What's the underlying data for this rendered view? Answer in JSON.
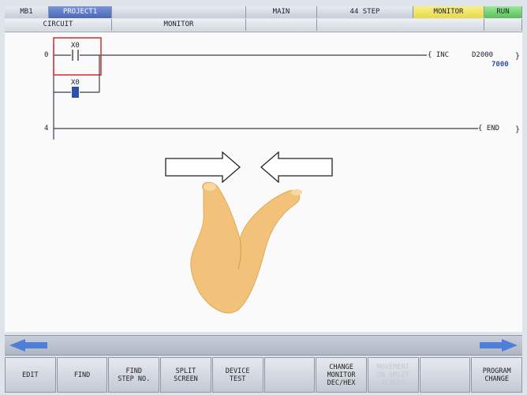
{
  "header": {
    "cells": [
      {
        "text": "MB1",
        "style": "normal"
      },
      {
        "text": "PROJECT1",
        "style": "proj"
      },
      {
        "text": "",
        "style": "normal"
      },
      {
        "text": "MAIN",
        "style": "normal"
      },
      {
        "text": "44 STEP",
        "style": "normal"
      },
      {
        "text": "MONITOR",
        "style": "mon"
      },
      {
        "text": "RUN",
        "style": "run"
      }
    ]
  },
  "subheader": {
    "cells": [
      "CIRCUIT",
      "MONITOR",
      "",
      "",
      ""
    ]
  },
  "ladder": {
    "rungs": [
      {
        "step": "0",
        "contact": "X0",
        "instruction": "{ INC",
        "device": "D2000",
        "value": "7000"
      },
      {
        "step": "",
        "contact": "X0"
      },
      {
        "step": "4",
        "instruction": "{ END"
      }
    ]
  },
  "gesture": {
    "left_arrow_icon": "arrow-right-outline",
    "right_arrow_icon": "arrow-left-outline",
    "hand_icon": "pinch-hand"
  },
  "navigation": {
    "left_icon": "arrow-left-blue",
    "right_icon": "arrow-right-blue"
  },
  "function_keys": [
    {
      "label": "EDIT",
      "disabled": false
    },
    {
      "label": "FIND",
      "disabled": false
    },
    {
      "label": "FIND\nSTEP NO.",
      "disabled": false
    },
    {
      "label": "SPLIT\nSCREEN",
      "disabled": false
    },
    {
      "label": "DEVICE\nTEST",
      "disabled": false
    },
    {
      "label": "",
      "disabled": false
    },
    {
      "label": "CHANGE\nMONITOR\nDEC/HEX",
      "disabled": false
    },
    {
      "label": "MOVEMENT\nON SPLIT\nSCREEN",
      "disabled": true
    },
    {
      "label": "",
      "disabled": false
    },
    {
      "label": "PROGRAM\nCHANGE",
      "disabled": false
    }
  ],
  "colors": {
    "accent_blue": "#4b66b8",
    "selection_red": "#d9363e",
    "monitor_yellow": "#e6d94a",
    "run_green": "#58c058",
    "hand_skin": "#f2c27a"
  }
}
